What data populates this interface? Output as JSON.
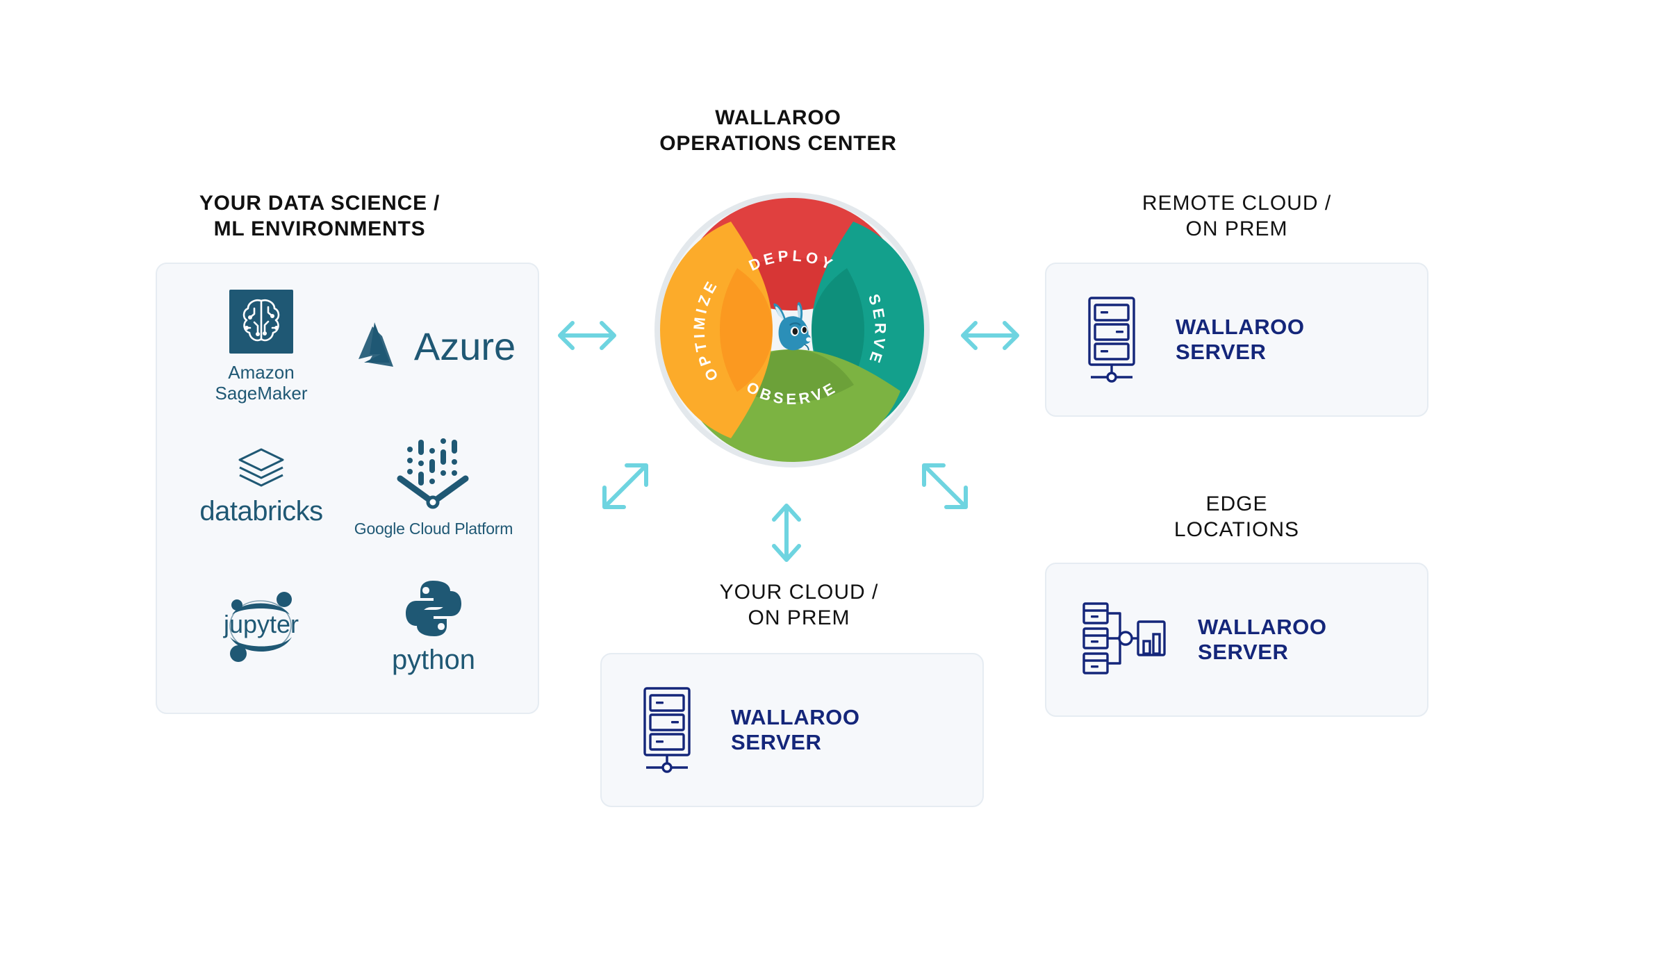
{
  "headings": {
    "center": "WALLAROO\nOPERATIONS CENTER",
    "left": "YOUR DATA SCIENCE /\nML ENVIRONMENTS",
    "right": "REMOTE CLOUD /\nON PREM",
    "bottom": "YOUR CLOUD /\nON PREM",
    "edge": "EDGE\nLOCATIONS"
  },
  "hub": {
    "segments": [
      {
        "label": "DEPLOY",
        "color": "#e0403f",
        "shadow": "#cf2e2e",
        "position": "top"
      },
      {
        "label": "SERVE",
        "color": "#13a08c",
        "shadow": "#0c8370",
        "position": "right"
      },
      {
        "label": "OBSERVE",
        "color": "#7cb342",
        "shadow": "#5f9233",
        "position": "bottom"
      },
      {
        "label": "OPTIMIZE",
        "color": "#fcab2a",
        "shadow": "#f98b17",
        "position": "left"
      }
    ],
    "ring_color": "#e3e8ec",
    "hub_face_color": "#f2f5f7",
    "mascot": "kangaroo-head",
    "mascot_color": "#2b8fb8"
  },
  "environments": {
    "logos": [
      {
        "name": "amazon-sagemaker",
        "caption": "Amazon\nSageMaker"
      },
      {
        "name": "microsoft-azure",
        "caption": "Azure"
      },
      {
        "name": "databricks",
        "caption": "databricks"
      },
      {
        "name": "google-cloud-platform",
        "caption": "Google Cloud Platform"
      },
      {
        "name": "jupyter",
        "caption": "jupyter"
      },
      {
        "name": "python",
        "caption": "python"
      }
    ],
    "logo_color": "#1f5874"
  },
  "cards": {
    "remote": {
      "title": "WALLAROO\nSERVER",
      "icon": "server-rack-icon"
    },
    "edge": {
      "title": "WALLAROO\nSERVER",
      "icon": "edge-network-icon"
    },
    "cloud": {
      "title": "WALLAROO\nSERVER",
      "icon": "server-rack-icon"
    }
  },
  "arrows": {
    "color": "#6ed4e0",
    "items": [
      {
        "name": "arrow-left-horizontal",
        "direction": "bidirectional-horizontal"
      },
      {
        "name": "arrow-right-horizontal",
        "direction": "bidirectional-horizontal"
      },
      {
        "name": "arrow-diagonal-sw",
        "direction": "bidirectional-diagonal-ne-sw"
      },
      {
        "name": "arrow-diagonal-se",
        "direction": "bidirectional-diagonal-nw-se"
      },
      {
        "name": "arrow-down-vertical",
        "direction": "bidirectional-vertical"
      }
    ]
  },
  "colors": {
    "card_bg": "#f6f8fb",
    "card_border": "#e6ecf2",
    "navy": "#14267a",
    "logo_blue": "#1f5874",
    "heading_black": "#111111"
  }
}
